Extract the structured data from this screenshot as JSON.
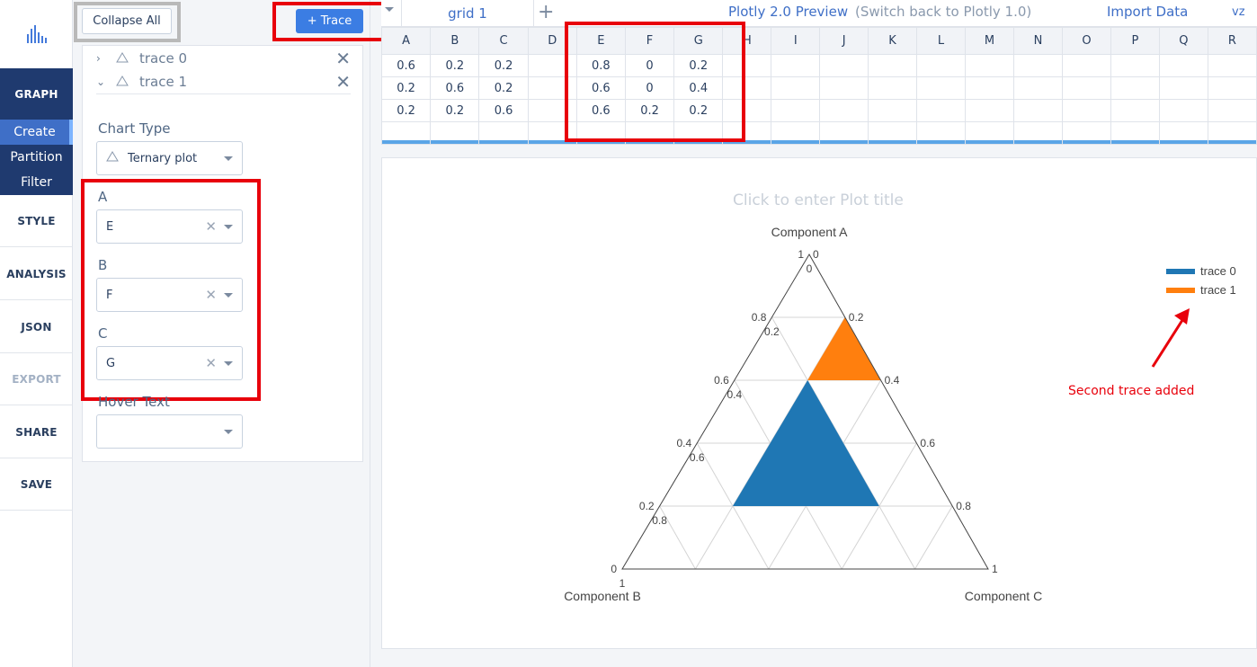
{
  "nav": {
    "graph": "GRAPH",
    "sub": [
      "Create",
      "Partition",
      "Filter"
    ],
    "items": [
      "STYLE",
      "ANALYSIS",
      "JSON",
      "EXPORT",
      "SHARE",
      "SAVE"
    ]
  },
  "panel": {
    "collapse_label": "Collapse All",
    "add_trace_label": "+ Trace",
    "traces": [
      "trace 0",
      "trace 1"
    ],
    "chart_type_label": "Chart Type",
    "chart_type_value": "Ternary plot",
    "field_a_label": "A",
    "field_a_value": "E",
    "field_b_label": "B",
    "field_b_value": "F",
    "field_c_label": "C",
    "field_c_value": "G",
    "hover_text_label": "Hover Text"
  },
  "topbar": {
    "tab": "grid 1",
    "preview": "Plotly 2.0 Preview",
    "switch_back": "(Switch back to Plotly 1.0)",
    "import": "Import Data",
    "user": "vz"
  },
  "grid": {
    "columns": [
      "A",
      "B",
      "C",
      "D",
      "E",
      "F",
      "G",
      "H",
      "I",
      "J",
      "K",
      "L",
      "M",
      "N",
      "O",
      "P",
      "Q",
      "R"
    ],
    "rows": [
      [
        "0.6",
        "0.2",
        "0.2",
        "",
        "0.8",
        "0",
        "0.2"
      ],
      [
        "0.2",
        "0.6",
        "0.2",
        "",
        "0.6",
        "0",
        "0.4"
      ],
      [
        "0.2",
        "0.2",
        "0.6",
        "",
        "0.6",
        "0.2",
        "0.2"
      ]
    ]
  },
  "plot": {
    "title_placeholder": "Click to enter Plot title",
    "annotation": "Second trace added",
    "annotation_color": "#e8000b"
  },
  "chart_data": {
    "type": "area",
    "subtype": "ternary",
    "xlabel": "",
    "axis_labels": {
      "a": "Component A",
      "b": "Component B",
      "c": "Component C"
    },
    "ticks": [
      "0",
      "0.2",
      "0.4",
      "0.6",
      "0.8",
      "1"
    ],
    "legend_position": "top-right",
    "series": [
      {
        "name": "trace 0",
        "color": "#1f77b4",
        "a": [
          0.6,
          0.2,
          0.2
        ],
        "b": [
          0.2,
          0.6,
          0.2
        ],
        "c": [
          0.2,
          0.2,
          0.6
        ]
      },
      {
        "name": "trace 1",
        "color": "#ff7f0e",
        "a": [
          0.8,
          0.6,
          0.6
        ],
        "b": [
          0,
          0,
          0.2
        ],
        "c": [
          0.2,
          0.4,
          0.2
        ]
      }
    ]
  }
}
